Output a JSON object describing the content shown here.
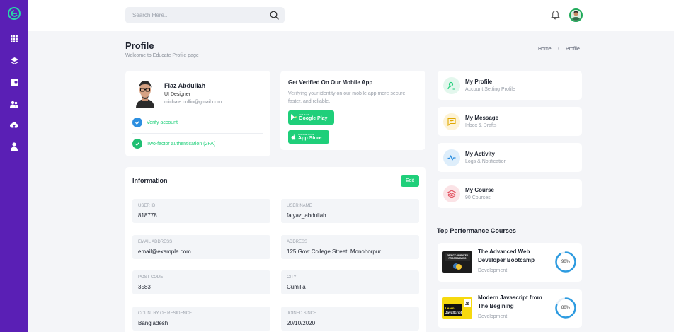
{
  "topbar": {
    "search_placeholder": "Search Here..."
  },
  "header": {
    "title": "Profile",
    "subtitle": "Welcome to Educate Profile page",
    "breadcrumb": [
      "Home",
      "Profile"
    ]
  },
  "profile": {
    "name": "Fiaz Abdullah",
    "role": "UI Designer",
    "email": "michale.collin@gmail.com",
    "verify_label": "Verify account",
    "twofa_label": "Two-factor authentication (2FA)"
  },
  "verify": {
    "title": "Get Verified On Our Mobile App",
    "description": "Verifying your identity on our mobile app more secure, faster, and reliable.",
    "google_small": "GET IT ON",
    "google_large": "Google Play",
    "apple_small": "Download on the",
    "apple_large": "App Store"
  },
  "information": {
    "title": "Information",
    "edit_label": "Edit",
    "fields": [
      {
        "label": "User ID",
        "value": "818778"
      },
      {
        "label": "User Name",
        "value": "faiyaz_abdullah"
      },
      {
        "label": "Email Address",
        "value": "email@example.com"
      },
      {
        "label": "Address",
        "value": "125 Govt College Street, Monohorpur"
      },
      {
        "label": "Post Code",
        "value": "3583"
      },
      {
        "label": "City",
        "value": "Cumilla"
      },
      {
        "label": "Country of Residence",
        "value": "Bangladesh"
      },
      {
        "label": "Joined Since",
        "value": "20/10/2020"
      }
    ]
  },
  "side_menu": [
    {
      "title": "My Profile",
      "subtitle": "Account Setting Profile",
      "icon": "user-icon",
      "color": "#1fcf7a",
      "bg": "#e3f7ed"
    },
    {
      "title": "My Message",
      "subtitle": "Inbox & Drafts",
      "icon": "message-icon",
      "color": "#e0a800",
      "bg": "#fdf3d6"
    },
    {
      "title": "My Activity",
      "subtitle": "Logs & Notification",
      "icon": "activity-icon",
      "color": "#2d8fe0",
      "bg": "#deeefb"
    },
    {
      "title": "My Course",
      "subtitle": "90 Courses",
      "icon": "layers-icon",
      "color": "#e04b5a",
      "bg": "#fbe3e6"
    }
  ],
  "top_courses": {
    "title": "Top Performance Courses",
    "items": [
      {
        "title": "The Advanced Web Developer Bootcamp",
        "category": "Development",
        "progress": 90,
        "progress_label": "90%",
        "thumb_text": "OBJECT ORIENTED PROGRAMMING"
      },
      {
        "title": "Modern Javascript from The Begining",
        "category": "Development",
        "progress": 80,
        "progress_label": "80%",
        "thumb_text": "Learn JavaScript"
      }
    ]
  },
  "colors": {
    "sidebar": "#5a1fb5",
    "accent": "#1fcf7a",
    "ring": "#2d9be0"
  }
}
